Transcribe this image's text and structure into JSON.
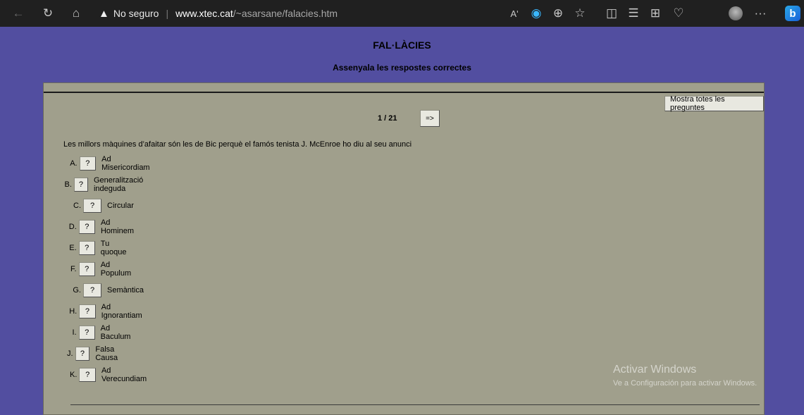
{
  "browser": {
    "security_text": "No seguro",
    "url_host": "www.xtec.cat",
    "url_path": "/~asarsane/falacies.htm",
    "reader_label": "Aʹ",
    "more_label": "···",
    "bing_label": "b"
  },
  "page": {
    "title": "FAL·LÀCIES",
    "subtitle": "Assenyala les respostes correctes",
    "show_all_label": "Mostra totes les preguntes",
    "counter": "1 / 21",
    "next_label": "=>",
    "question": "Les millors màquines d’afaitar són les de Bic perquè el famós tenista J. McEnroe ho diu al seu anunci",
    "button_label": "?",
    "options": [
      {
        "letter": "A.",
        "text": "Ad Misericordiam"
      },
      {
        "letter": "B.",
        "text": "Generalització indeguda"
      },
      {
        "letter": "C.",
        "text": "Circular"
      },
      {
        "letter": "D.",
        "text": "Ad Hominem"
      },
      {
        "letter": "E.",
        "text": "Tu quoque"
      },
      {
        "letter": "F.",
        "text": "Ad Populum"
      },
      {
        "letter": "G.",
        "text": "Semàntica"
      },
      {
        "letter": "H.",
        "text": "Ad Ignorantiam"
      },
      {
        "letter": "I.",
        "text": "Ad Baculum"
      },
      {
        "letter": "J.",
        "text": "Falsa Causa"
      },
      {
        "letter": "K.",
        "text": "Ad Verecundiam"
      }
    ]
  },
  "watermark": {
    "line1": "Activar Windows",
    "line2": "Ve a Configuración para activar Windows."
  }
}
